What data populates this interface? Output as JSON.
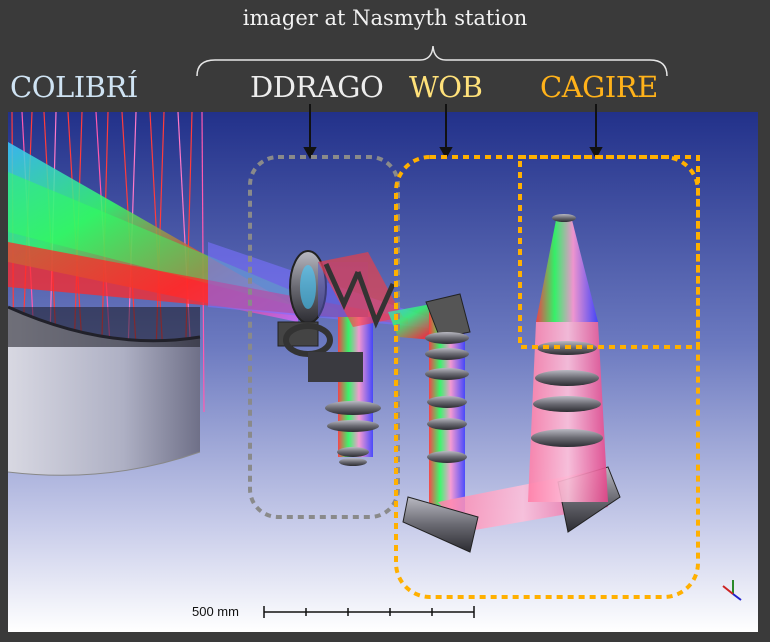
{
  "header": {
    "title": "imager at Nasmyth station",
    "labels": {
      "colibri": "COLIBRÍ",
      "ddrago": "DDRAGO",
      "wob": "WOB",
      "cagire": "CAGIRE"
    }
  },
  "scale_bar": {
    "label": "500 mm"
  },
  "colors": {
    "frame_bg": "#3a3a3a",
    "ddrago_box": "#8a8a8a",
    "wob_box": "#ffb000",
    "cagire_box": "#ffb000"
  },
  "icons": [
    "axis-triad-icon"
  ]
}
